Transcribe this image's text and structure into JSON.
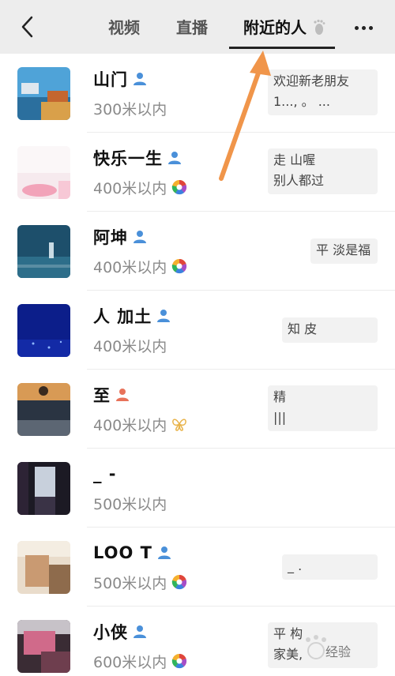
{
  "header": {
    "tabs": [
      {
        "label": "视频",
        "active": false
      },
      {
        "label": "直播",
        "active": false
      },
      {
        "label": "附近的人",
        "active": true
      }
    ],
    "icons": {
      "back": "back-chevron-icon",
      "more": "more-dots-icon",
      "footprint": "footprint-icon"
    }
  },
  "people": [
    {
      "name": "山门",
      "distance": "300米以内",
      "gender": "male",
      "moments": false,
      "bubble": [
        "欢迎新老朋友",
        "1...,   。   ..."
      ]
    },
    {
      "name": "快乐一生",
      "distance": "400米以内",
      "gender": "male",
      "moments": true,
      "bubble": [
        "走      山喔",
        "别人都过"
      ]
    },
    {
      "name": "阿坤",
      "distance": "400米以内",
      "gender": "male",
      "moments": true,
      "bubble": [
        "平  淡是福"
      ]
    },
    {
      "name": "人    加土",
      "distance": "400米以内",
      "gender": "male",
      "moments": true,
      "bubble": [
        "知          皮"
      ]
    },
    {
      "name": "至",
      "distance": "400米以内",
      "gender": "female",
      "moments": false,
      "bubble": [
        "     精  ",
        "|||"
      ]
    },
    {
      "name": "_ -",
      "distance": "500米以内",
      "gender": "none",
      "moments": false,
      "bubble": []
    },
    {
      "name": "LOO T",
      "distance": "500米以内",
      "gender": "male",
      "moments": true,
      "bubble": [
        "  _ ."
      ]
    },
    {
      "name": "小侠",
      "distance": "600米以内",
      "gender": "male",
      "moments": true,
      "bubble": [
        "平   构  ",
        "   家美,"
      ]
    }
  ],
  "watermark": {
    "text": "经验"
  },
  "colors": {
    "header_bg": "#ededed",
    "male": "#4a90d9",
    "female": "#e8725a",
    "arrow": "#f0954a"
  }
}
